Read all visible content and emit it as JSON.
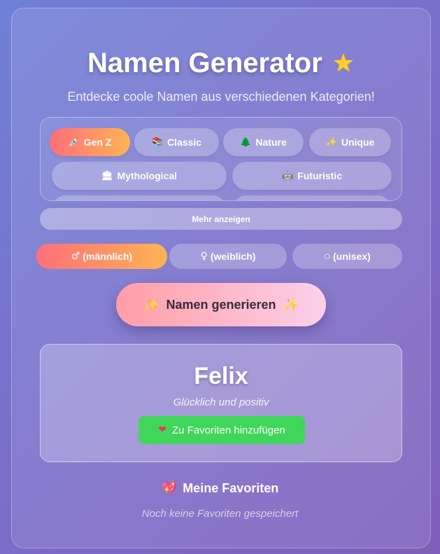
{
  "header": {
    "title": "Namen Generator",
    "title_icon": "star-icon",
    "subtitle": "Entdecke coole Namen aus verschiedenen Kategorien!"
  },
  "categories": [
    {
      "label": "Gen Z",
      "icon": "syringe-icon",
      "glyph": "💉",
      "active": true
    },
    {
      "label": "Classic",
      "icon": "books-icon",
      "glyph": "📚",
      "active": false
    },
    {
      "label": "Nature",
      "icon": "tree-icon",
      "glyph": "🌲",
      "active": false
    },
    {
      "label": "Unique",
      "icon": "sparkles-icon",
      "glyph": "✨",
      "active": false
    },
    {
      "label": "Mythological",
      "icon": "temple-icon",
      "glyph": "🏛",
      "active": false
    },
    {
      "label": "Futuristic",
      "icon": "robot-icon",
      "glyph": "🤖",
      "active": false
    }
  ],
  "more_label": "Mehr anzeigen",
  "genders": [
    {
      "label": "(männlich)",
      "glyph": "♂",
      "icon": "male-icon",
      "active": true
    },
    {
      "label": "(weiblich)",
      "glyph": "♀",
      "icon": "female-icon",
      "active": false
    },
    {
      "label": "(unisex)",
      "glyph": "⚪",
      "icon": "unisex-icon",
      "active": false
    }
  ],
  "generate": {
    "label": "Namen generieren",
    "glyph": "✨"
  },
  "result": {
    "name": "Felix",
    "meaning": "Glücklich und positiv",
    "favorite_label": "Zu Favoriten hinzufügen",
    "favorite_glyph": "❤"
  },
  "favorites": {
    "title": "Meine Favoriten",
    "glyph": "💖",
    "empty_text": "Noch keine Favoriten gespeichert"
  },
  "colors": {
    "accent_gradient_start": "#ff6f7a",
    "accent_gradient_end": "#ffb454",
    "favorite_button": "#3fd65a"
  }
}
